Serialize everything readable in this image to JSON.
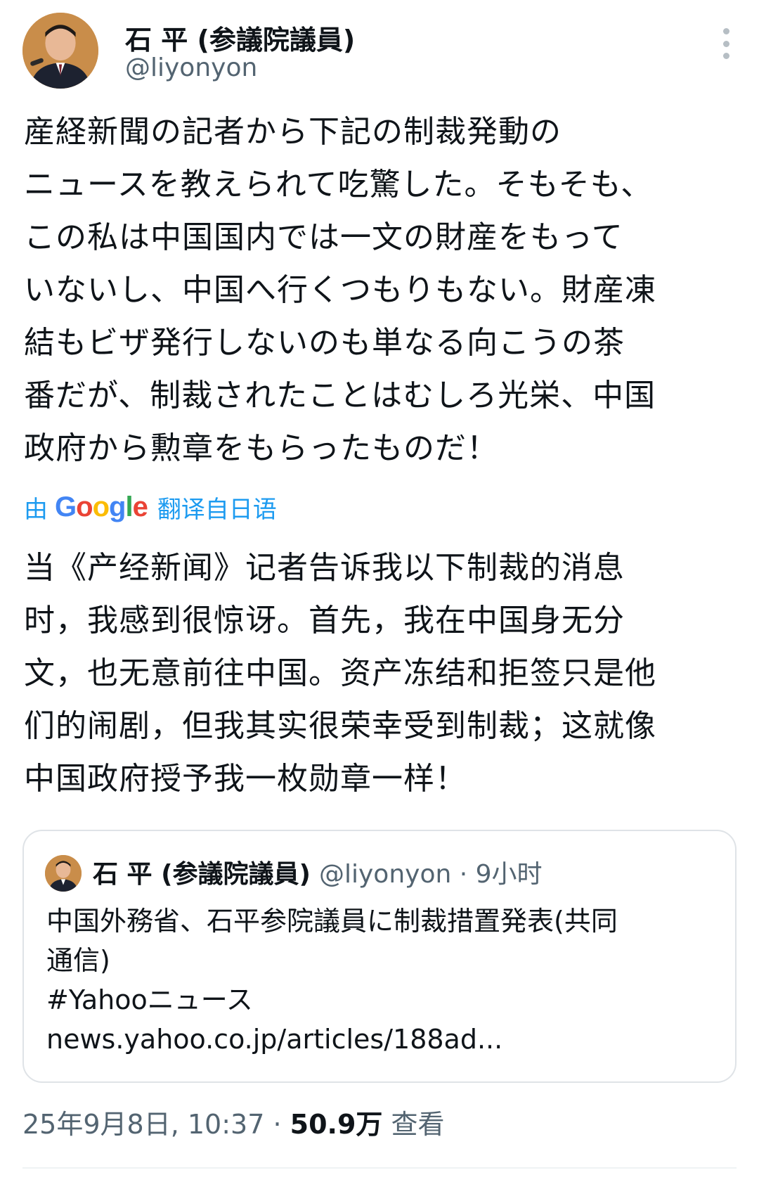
{
  "author": {
    "name": "石 平 (参議院議員)",
    "handle": "@liyonyon"
  },
  "more_icon": "more-vertical-icon",
  "tweet": {
    "original_lines": [
      "産経新聞の記者から下記の制裁発動の",
      "ニュースを教えられて吃驚した。そもそも、",
      "この私は中国国内では一文の財産をもって",
      "いないし、中国へ行くつもりもない。財産凍",
      "結もビザ発行しないのも単なる向こうの茶",
      "番だが、制裁されたことはむしろ光栄、中国",
      "政府から勲章をもらったものだ！"
    ],
    "translation_prefix": "由",
    "translation_brand": "Google",
    "translation_suffix": "翻译自日语",
    "translated_lines": [
      "当《产经新闻》记者告诉我以下制裁的消息",
      "时，我感到很惊讶。首先，我在中国身无分",
      "文，也无意前往中国。资产冻结和拒签只是他",
      "们的闹剧，但我其实很荣幸受到制裁；这就像",
      "中国政府授予我一枚勋章一样！"
    ]
  },
  "quote": {
    "name": "石 平 (参議院議員)",
    "handle": "@liyonyon",
    "time": " · 9小时",
    "text_lines": [
      "中国外務省、石平参院議員に制裁措置発表(共同",
      "通信)",
      "#Yahooニュース",
      "news.yahoo.co.jp/articles/188ad..."
    ]
  },
  "meta": {
    "datetime": "25年9月8日, 10:37 · ",
    "views_count": "50.9万",
    "views_label": " 查看"
  },
  "colors": {
    "text": "#0f1419",
    "secondary": "#536471",
    "link": "#1d9bf0",
    "google_blue": "#4285F4",
    "google_red": "#EA4335",
    "google_yellow": "#FBBC05",
    "google_green": "#34A853"
  }
}
